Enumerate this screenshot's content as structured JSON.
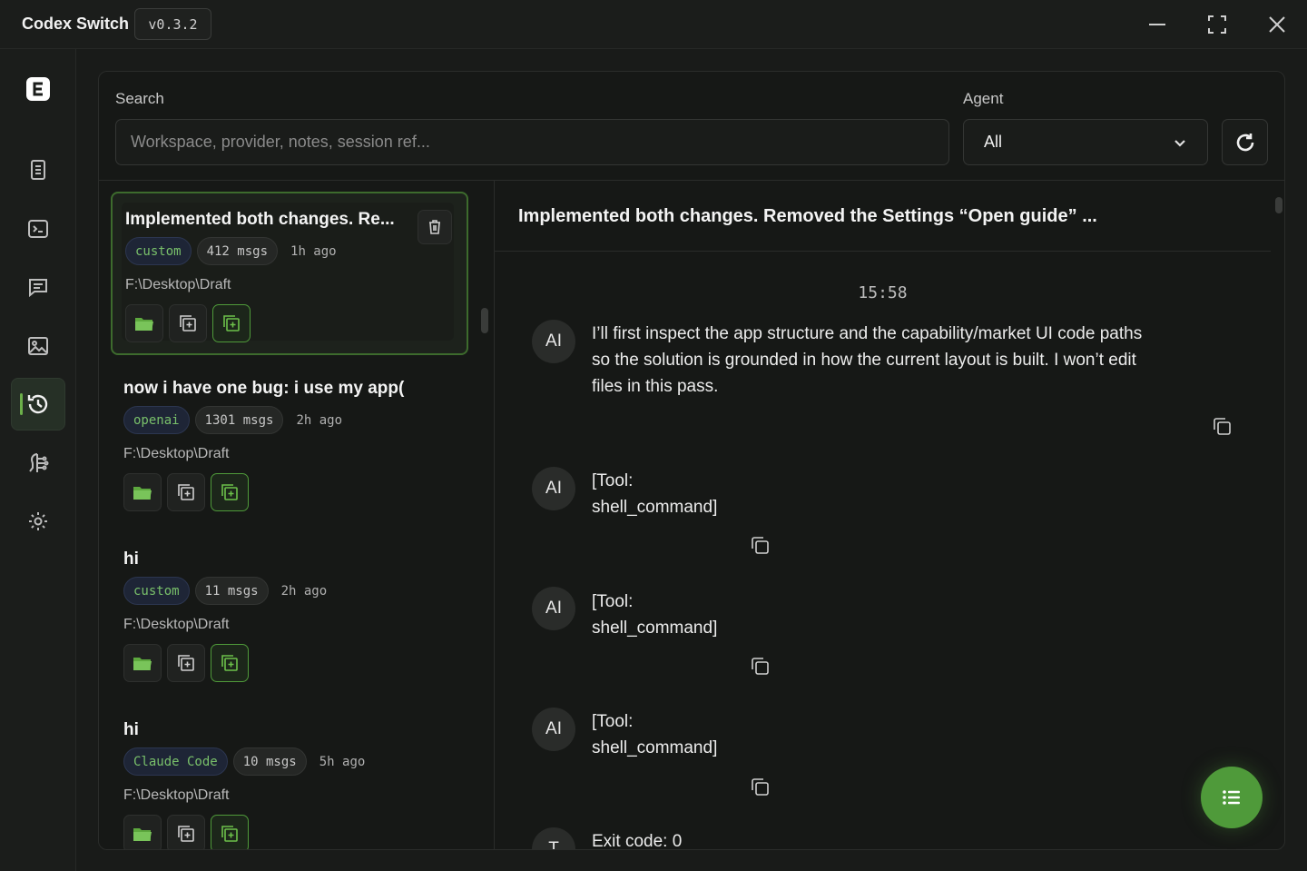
{
  "window": {
    "title": "Codex Switch",
    "version": "v0.3.2"
  },
  "filters": {
    "search_label": "Search",
    "search_placeholder": "Workspace, provider, notes, session ref...",
    "agent_label": "Agent",
    "agent_value": "All"
  },
  "sessions": [
    {
      "title": "Implemented both changes. Re...",
      "provider": "custom",
      "msgs": "412 msgs",
      "time": "1h ago",
      "path": "F:\\Desktop\\Draft"
    },
    {
      "title": "now i have one bug: i use my app(",
      "provider": "openai",
      "msgs": "1301 msgs",
      "time": "2h ago",
      "path": "F:\\Desktop\\Draft"
    },
    {
      "title": "hi",
      "provider": "custom",
      "msgs": "11 msgs",
      "time": "2h ago",
      "path": "F:\\Desktop\\Draft"
    },
    {
      "title": "hi",
      "provider": "Claude Code",
      "msgs": "10 msgs",
      "time": "5h ago",
      "path": "F:\\Desktop\\Draft"
    }
  ],
  "conversation": {
    "title": "Implemented both changes. Removed the Settings “Open guide” ...",
    "timestamp": "15:58",
    "messages": [
      {
        "avatar": "AI",
        "line1": "I’ll first inspect the app structure and the capability/market UI code paths",
        "line2": "so the solution is grounded in how the current layout is built. I won’t edit",
        "line3": "files in this pass."
      },
      {
        "avatar": "AI",
        "line1": "[Tool:",
        "line2": "shell_command]"
      },
      {
        "avatar": "AI",
        "line1": "[Tool:",
        "line2": "shell_command]"
      },
      {
        "avatar": "AI",
        "line1": "[Tool:",
        "line2": "shell_command]"
      },
      {
        "avatar": "T",
        "line1": "Exit code: 0"
      }
    ]
  },
  "colors": {
    "accent": "#4f9a3a",
    "background": "#191b19",
    "panel": "#161816"
  }
}
